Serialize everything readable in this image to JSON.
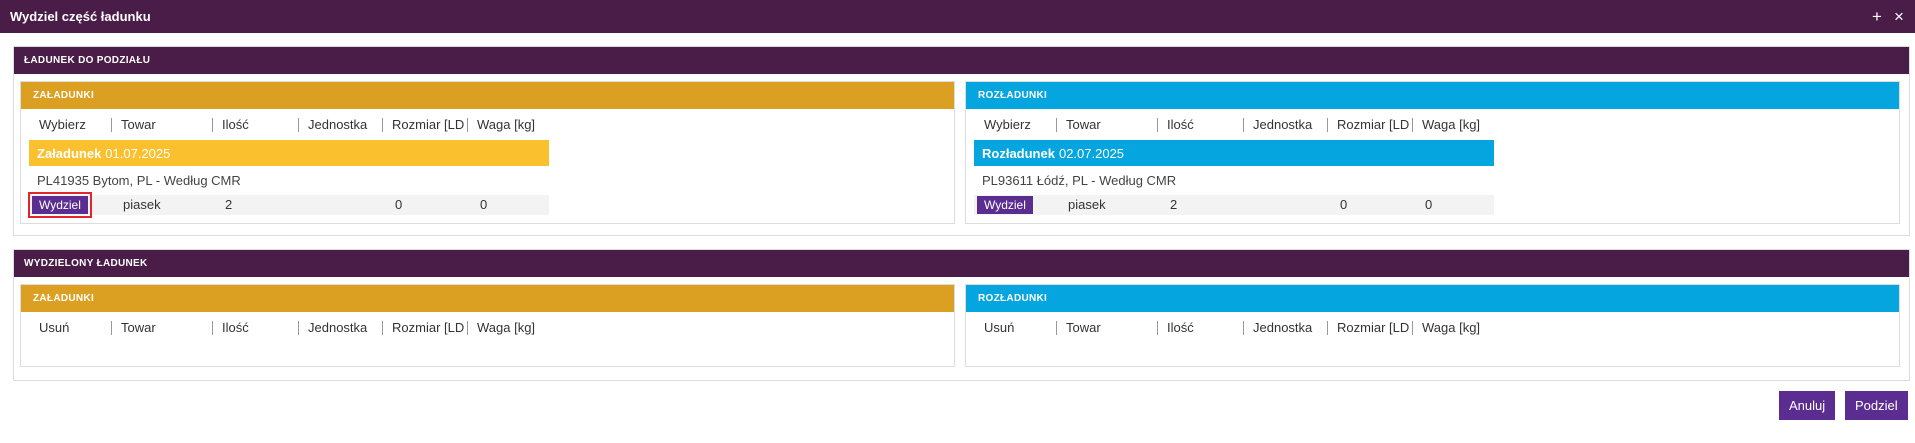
{
  "dialog": {
    "title": "Wydziel część ładunku",
    "add_icon_glyph": "+",
    "close_icon_glyph": "×"
  },
  "to_split": {
    "header": "ŁADUNEK DO PODZIAŁU",
    "loading": {
      "header": "ZAŁADUNKI",
      "columns": [
        "Wybierz",
        "Towar",
        "Ilość",
        "Jednostka",
        "Rozmiar [LD",
        "Waga [kg]"
      ],
      "group_label": "Załadunek",
      "group_date": "01.07.2025",
      "address": "PL41935 Bytom, PL - Według CMR",
      "item": {
        "action": "Wydziel",
        "towar": "piasek",
        "ilosc": "2",
        "rozmiar": "0",
        "waga": "0"
      }
    },
    "unloading": {
      "header": "ROZŁADUNKI",
      "columns": [
        "Wybierz",
        "Towar",
        "Ilość",
        "Jednostka",
        "Rozmiar [LD",
        "Waga [kg]"
      ],
      "group_label": "Rozładunek",
      "group_date": "02.07.2025",
      "address": "PL93611 Łódź, PL - Według CMR",
      "item": {
        "action": "Wydziel",
        "towar": "piasek",
        "ilosc": "2",
        "rozmiar": "0",
        "waga": "0"
      }
    }
  },
  "split": {
    "header": "WYDZIELONY ŁADUNEK",
    "loading": {
      "header": "ZAŁADUNKI",
      "columns": [
        "Usuń",
        "Towar",
        "Ilość",
        "Jednostka",
        "Rozmiar [LD",
        "Waga [kg]"
      ]
    },
    "unloading": {
      "header": "ROZŁADUNKI",
      "columns": [
        "Usuń",
        "Towar",
        "Ilość",
        "Jednostka",
        "Rozmiar [LD",
        "Waga [kg]"
      ]
    }
  },
  "footer": {
    "cancel_label": "Anuluj",
    "split_label": "Podziel"
  },
  "colors": {
    "header_purple": "#4a1c48",
    "loading_orange": "#dba021",
    "loading_group_yellow": "#fbc02d",
    "unloading_blue": "#05a6e0",
    "button_purple": "#5c2d91",
    "highlight_red": "#e3262e"
  }
}
